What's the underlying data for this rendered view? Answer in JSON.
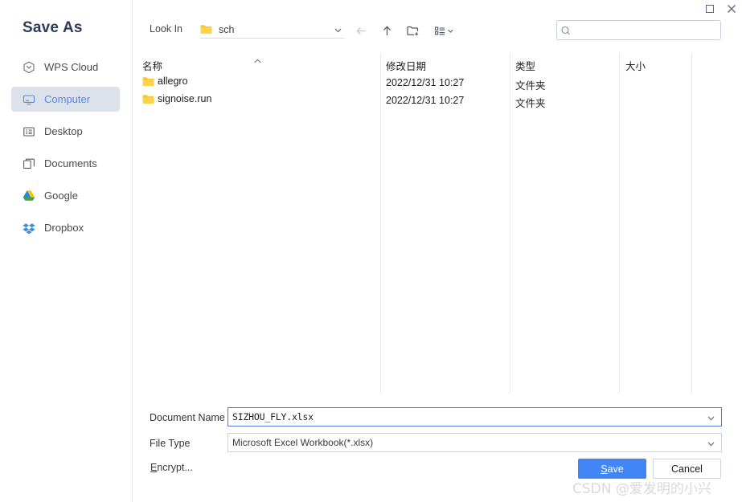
{
  "window": {
    "maximize_icon": "square-icon",
    "close_icon": "close-icon"
  },
  "dialog": {
    "title": "Save As"
  },
  "sidebar": {
    "items": [
      {
        "label": "WPS Cloud",
        "icon": "cloud-icon",
        "active": false
      },
      {
        "label": "Computer",
        "icon": "monitor-icon",
        "active": true
      },
      {
        "label": "Desktop",
        "icon": "desktop-icon",
        "active": false
      },
      {
        "label": "Documents",
        "icon": "documents-icon",
        "active": false
      },
      {
        "label": "Google",
        "icon": "google-drive-icon",
        "active": false
      },
      {
        "label": "Dropbox",
        "icon": "dropbox-icon",
        "active": false
      }
    ]
  },
  "toolbar": {
    "look_in_label": "Look In",
    "look_in_value": "sch",
    "look_in_icon": "folder-icon",
    "look_in_chevron": "chevron-down-icon",
    "back_icon": "arrow-left-icon",
    "up_icon": "arrow-up-icon",
    "new_folder_icon": "new-folder-icon",
    "view_options_icon": "list-view-icon",
    "view_options_chevron": "chevron-down-icon"
  },
  "search": {
    "icon": "search-icon",
    "value": "",
    "placeholder": ""
  },
  "file_list": {
    "columns": [
      {
        "key": "name",
        "label": "名称"
      },
      {
        "key": "modified",
        "label": "修改日期"
      },
      {
        "key": "type",
        "label": "类型"
      },
      {
        "key": "size",
        "label": "大小"
      }
    ],
    "sort_indicator": "chevron-up-icon",
    "rows": [
      {
        "name": "allegro",
        "icon": "folder-icon",
        "modified": "2022/12/31 10:27",
        "type": "文件夹",
        "size": ""
      },
      {
        "name": "signoise.run",
        "icon": "folder-icon",
        "modified": "2022/12/31 10:27",
        "type": "文件夹",
        "size": ""
      }
    ]
  },
  "form": {
    "document_name_label": "Document Name",
    "document_name_value": "SIZHOU_FLY.xlsx",
    "document_name_chevron": "chevron-down-icon",
    "file_type_label": "File Type",
    "file_type_value": "Microsoft Excel Workbook(*.xlsx)",
    "file_type_chevron": "chevron-down-icon",
    "encrypt_mnemonic": "E",
    "encrypt_rest": "ncrypt..."
  },
  "actions": {
    "save_mnemonic": "S",
    "save_rest": "ave",
    "cancel_label": "Cancel"
  },
  "watermark": {
    "text": "CSDN @爱发明的小兴"
  },
  "colors": {
    "accent_blue": "#4285f4",
    "title_navy": "#2b3d5e",
    "active_bg": "#dde2ea",
    "active_text": "#5686e8",
    "folder_yellow": "#fdc21c",
    "focus_border": "#4a7fd4"
  }
}
